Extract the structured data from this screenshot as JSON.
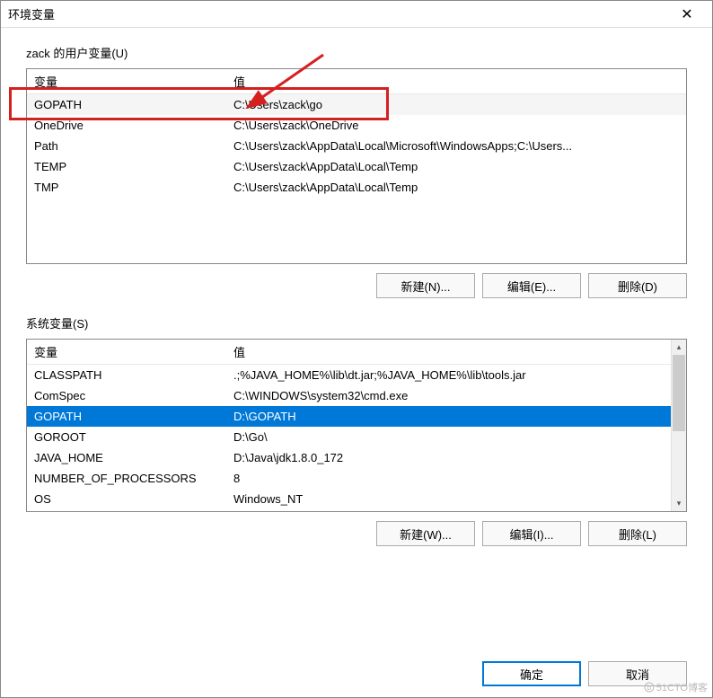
{
  "title": "环境变量",
  "user_section": {
    "label": "zack 的用户变量(U)",
    "headers": {
      "variable": "变量",
      "value": "值"
    },
    "rows": [
      {
        "variable": "GOPATH",
        "value": "C:\\Users\\zack\\go"
      },
      {
        "variable": "OneDrive",
        "value": "C:\\Users\\zack\\OneDrive"
      },
      {
        "variable": "Path",
        "value": "C:\\Users\\zack\\AppData\\Local\\Microsoft\\WindowsApps;C:\\Users..."
      },
      {
        "variable": "TEMP",
        "value": "C:\\Users\\zack\\AppData\\Local\\Temp"
      },
      {
        "variable": "TMP",
        "value": "C:\\Users\\zack\\AppData\\Local\\Temp"
      }
    ],
    "buttons": {
      "new": "新建(N)...",
      "edit": "编辑(E)...",
      "delete": "删除(D)"
    }
  },
  "system_section": {
    "label": "系统变量(S)",
    "headers": {
      "variable": "变量",
      "value": "值"
    },
    "rows": [
      {
        "variable": "CLASSPATH",
        "value": ".;%JAVA_HOME%\\lib\\dt.jar;%JAVA_HOME%\\lib\\tools.jar"
      },
      {
        "variable": "ComSpec",
        "value": "C:\\WINDOWS\\system32\\cmd.exe"
      },
      {
        "variable": "GOPATH",
        "value": "D:\\GOPATH"
      },
      {
        "variable": "GOROOT",
        "value": "D:\\Go\\"
      },
      {
        "variable": "JAVA_HOME",
        "value": "D:\\Java\\jdk1.8.0_172"
      },
      {
        "variable": "NUMBER_OF_PROCESSORS",
        "value": "8"
      },
      {
        "variable": "OS",
        "value": "Windows_NT"
      }
    ],
    "buttons": {
      "new": "新建(W)...",
      "edit": "编辑(I)...",
      "delete": "删除(L)"
    }
  },
  "footer": {
    "ok": "确定",
    "cancel": "取消"
  },
  "watermark": "51CTO博客"
}
